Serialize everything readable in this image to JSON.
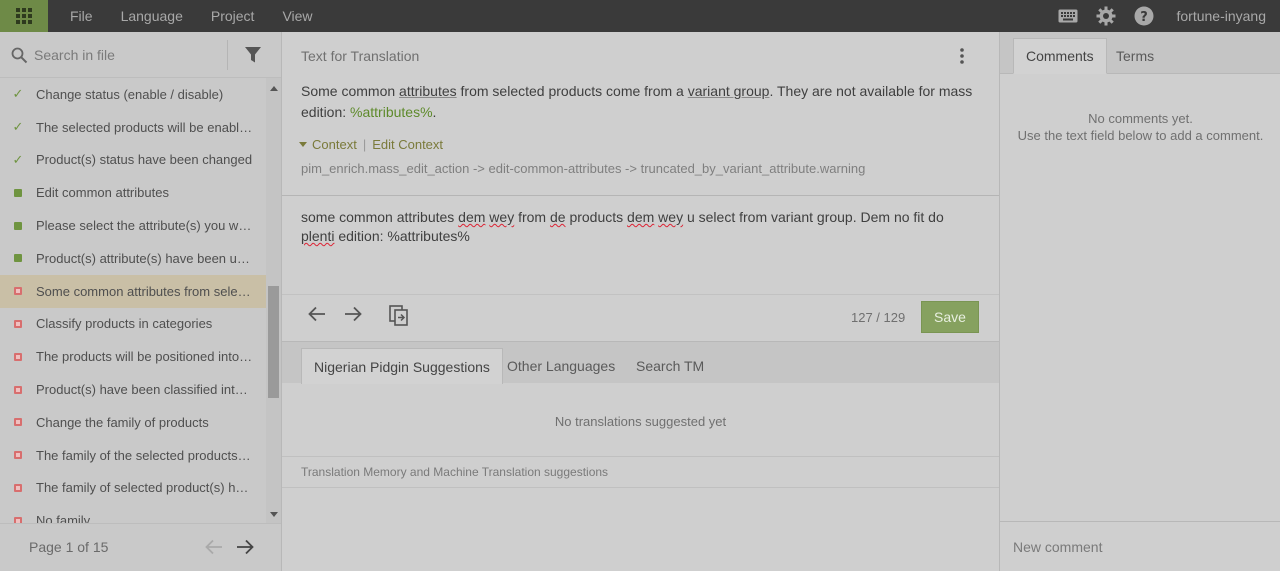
{
  "topbar": {
    "menu": [
      "File",
      "Language",
      "Project",
      "View"
    ],
    "user": "fortune-inyang"
  },
  "left": {
    "search_placeholder": "Search in file",
    "items": [
      {
        "status": "approved",
        "text": "Change status (enable / disable)"
      },
      {
        "status": "approved",
        "text": "The selected products will be enabled or disabled."
      },
      {
        "status": "approved",
        "text": "Product(s) status have been changed"
      },
      {
        "status": "translated",
        "text": "Edit common attributes"
      },
      {
        "status": "translated",
        "text": "Please select the attribute(s) you want to edit"
      },
      {
        "status": "translated",
        "text": "Product(s) attribute(s) have been updated"
      },
      {
        "status": "untranslated",
        "text": "Some common attributes from selected products",
        "active": true
      },
      {
        "status": "untranslated",
        "text": "Classify products in categories"
      },
      {
        "status": "untranslated",
        "text": "The products will be positioned into the"
      },
      {
        "status": "untranslated",
        "text": "Product(s) have been classified into the"
      },
      {
        "status": "untranslated",
        "text": "Change the family of products"
      },
      {
        "status": "untranslated",
        "text": "The family of the selected products will be"
      },
      {
        "status": "untranslated",
        "text": "The family of selected product(s) has been"
      },
      {
        "status": "untranslated",
        "text": "No family"
      }
    ],
    "pager": "Page 1 of 15"
  },
  "middle": {
    "header": "Text for Translation",
    "source": {
      "t1": "Some common ",
      "u1": "attributes",
      "t2": " from selected products come from a ",
      "u2": "variant group",
      "t3": ". They are not available for mass edition: ",
      "ph": "%attributes%",
      "t4": "."
    },
    "context_label": "Context",
    "edit_context_label": "Edit Context",
    "context_key": "pim_enrich.mass_edit_action -> edit-common-attributes -> truncated_by_variant_attribute.warning",
    "translation": {
      "t1": "some common attributes ",
      "s1": "dem",
      "t2": " ",
      "s2": "wey",
      "t3": "  from ",
      "s3": "de",
      "t4": " products ",
      "s4": "dem",
      "t5": " ",
      "s5": "wey",
      "t6": " u select  from variant group. Dem no fit do ",
      "s6": "plenti",
      "t7": " edition: %attributes%"
    },
    "counter": "127 / 129",
    "save_label": "Save",
    "tabs": [
      "Nigerian Pidgin Suggestions",
      "Other Languages",
      "Search TM"
    ],
    "no_suggestions": "No translations suggested yet",
    "footer": "Translation Memory and Machine Translation suggestions"
  },
  "right": {
    "tabs": [
      "Comments",
      "Terms"
    ],
    "no_comments_1": "No comments yet.",
    "no_comments_2": "Use the text field below to add a comment.",
    "new_comment_placeholder": "New comment"
  },
  "colors": {
    "accent_green": "#6e8a47",
    "save_green": "#86a15f",
    "untranslated_red": "#d86e6e",
    "placeholder_green": "#5e8a2b"
  }
}
